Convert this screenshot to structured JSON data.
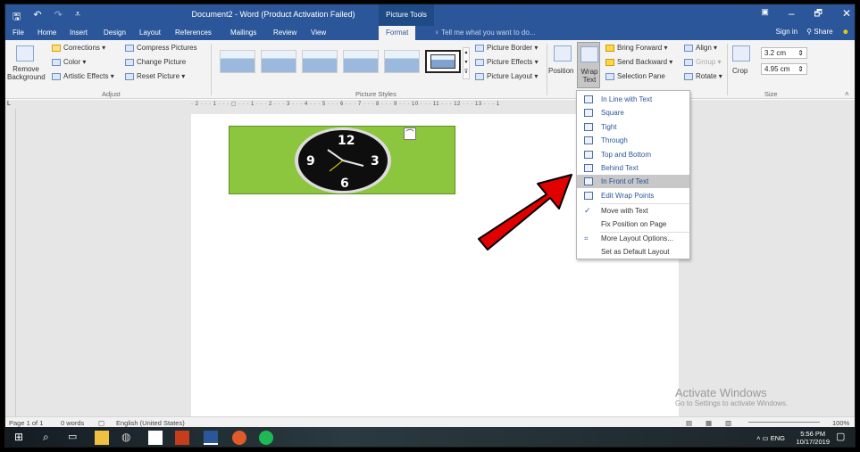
{
  "titlebar": {
    "title": "Document2 - Word (Product Activation Failed)",
    "context_label": "Picture Tools",
    "minimize": "–",
    "maximize": "🗗",
    "close": "✕"
  },
  "tabs": [
    "File",
    "Home",
    "Insert",
    "Design",
    "Layout",
    "References",
    "Mailings",
    "Review",
    "View",
    "Format"
  ],
  "active_tab": "Format",
  "tellme": "Tell me what you want to do...",
  "signin": "Sign in",
  "share": "Share",
  "ribbon": {
    "remove_bg": "Remove Background",
    "corrections": "Corrections",
    "color": "Color",
    "artistic": "Artistic Effects",
    "compress": "Compress Pictures",
    "change": "Change Picture",
    "reset": "Reset Picture",
    "adjust_label": "Adjust",
    "styles_label": "Picture Styles",
    "border": "Picture Border",
    "effects": "Picture Effects",
    "layout": "Picture Layout",
    "position": "Position",
    "wrap": "Wrap Text",
    "bring_forward": "Bring Forward",
    "send_backward": "Send Backward",
    "selection_pane": "Selection Pane",
    "align": "Align",
    "group": "Group",
    "rotate": "Rotate",
    "crop": "Crop",
    "height": "3.2 cm",
    "width": "4.95 cm",
    "size_label": "Size"
  },
  "ruler_scale": "· 2 · · · 1 · · · ▢ · · · 1 · · · 2 · · · 3 · · · 4 · · · 5 · · · 6 · · · 7 · · · 8 · · · 9 · · · 10 · · · 11 · · · 12 · · · 13 · · · 1",
  "wrap_menu": [
    {
      "label": "In Line with Text",
      "style": "accent"
    },
    {
      "label": "Square",
      "style": "accent"
    },
    {
      "label": "Tight",
      "style": "accent"
    },
    {
      "label": "Through",
      "style": "accent"
    },
    {
      "label": "Top and Bottom",
      "style": "accent"
    },
    {
      "label": "Behind Text",
      "style": "accent"
    },
    {
      "label": "In Front of Text",
      "style": "hl"
    },
    {
      "label": "Edit Wrap Points",
      "style": "accent"
    },
    {
      "label": "Move with Text",
      "style": "check"
    },
    {
      "label": "Fix Position on Page",
      "style": ""
    },
    {
      "label": "More Layout Options...",
      "style": ""
    },
    {
      "label": "Set as Default Layout",
      "style": ""
    }
  ],
  "watermark": {
    "line1": "Activate Windows",
    "line2": "Go to Settings to activate Windows."
  },
  "status": {
    "page": "Page 1 of 1",
    "words": "0 words",
    "language": "English (United States)",
    "zoom": "100%"
  },
  "taskbar": {
    "time": "5:56 PM",
    "date": "10/17/2019",
    "lang": "ENG"
  },
  "colors": {
    "word_blue": "#2b579a",
    "picture_green": "#8cc63f",
    "arrow_red": "#e10000"
  }
}
